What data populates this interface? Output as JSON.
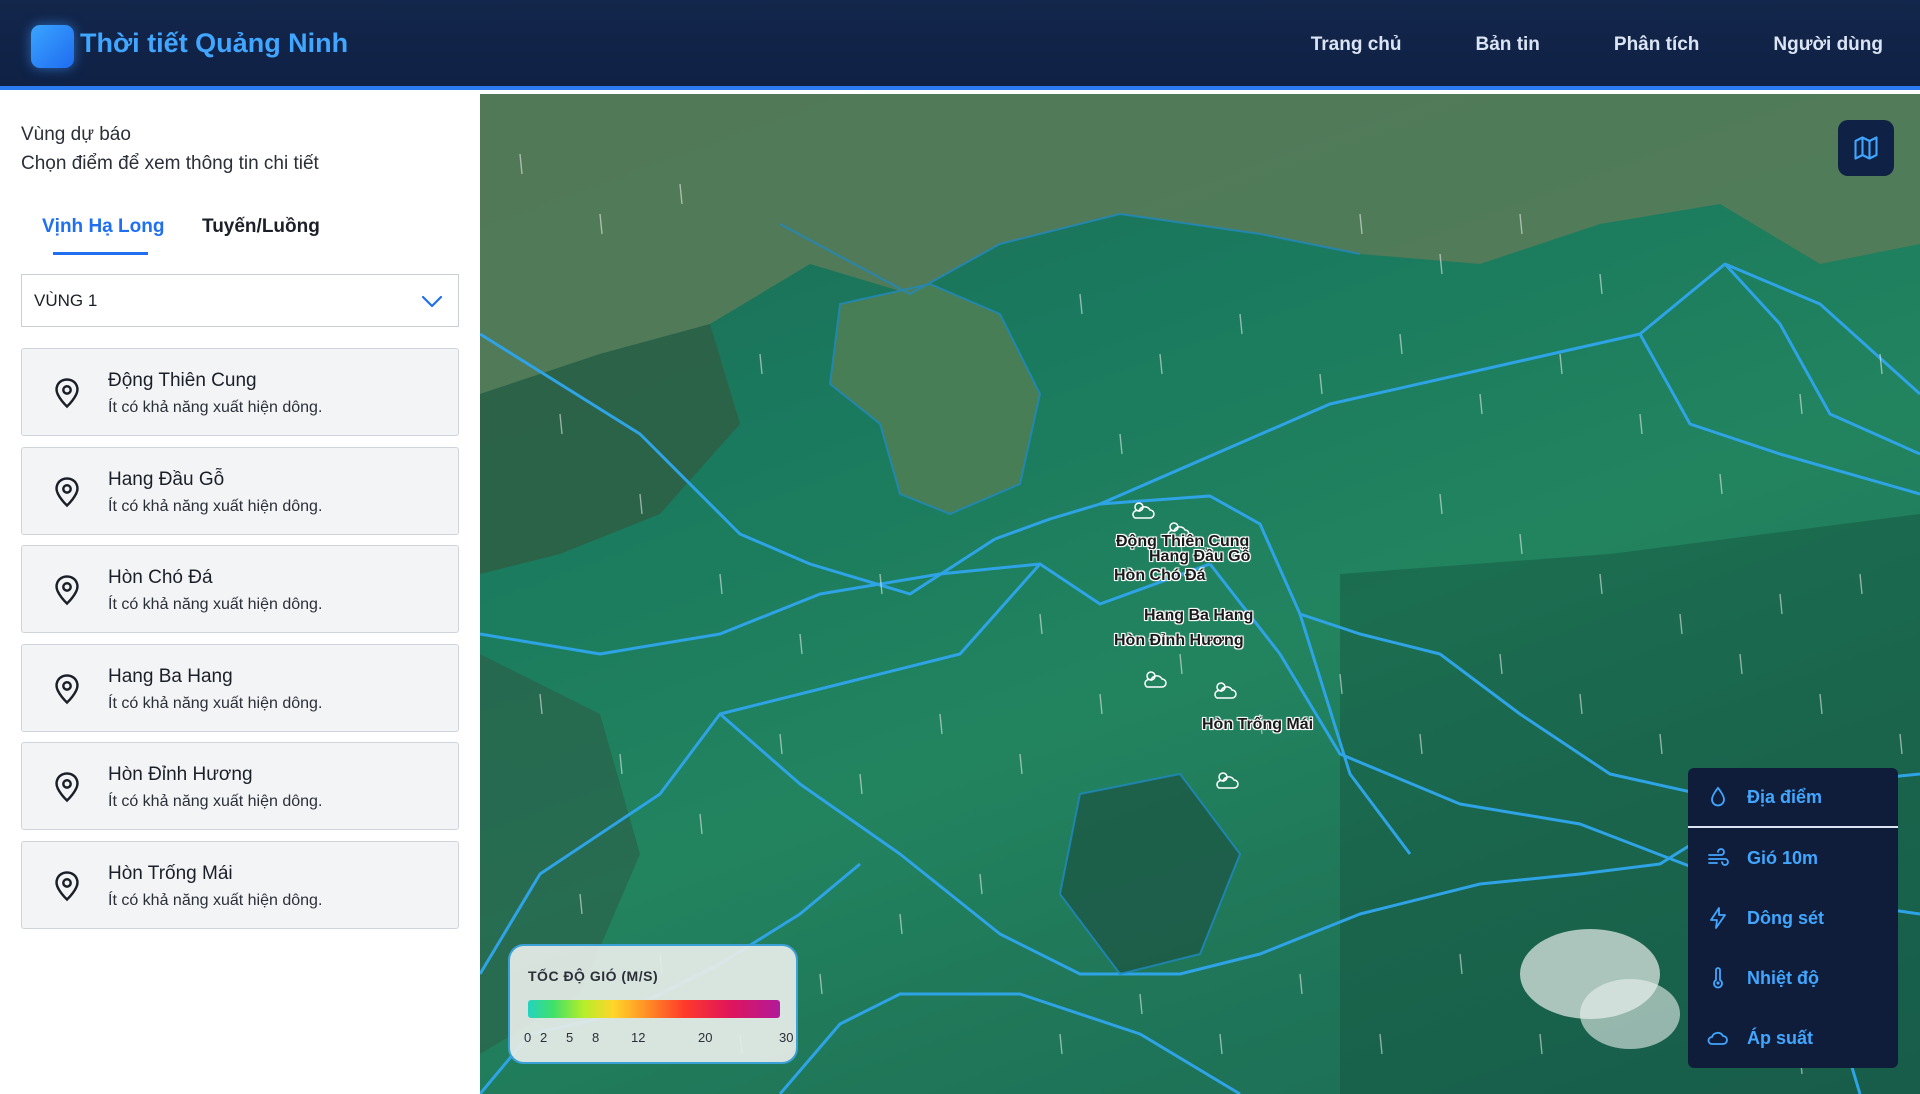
{
  "header": {
    "title": "Thời tiết Quảng Ninh",
    "nav": [
      "Trang chủ",
      "Bản tin",
      "Phân tích",
      "Người dùng"
    ]
  },
  "sidebar": {
    "title": "Vùng dự báo",
    "subtitle": "Chọn điểm để xem thông tin chi tiết",
    "tabs": [
      "Vịnh Hạ Long",
      "Tuyến/Luồng"
    ],
    "active_tab": "Vịnh Hạ Long",
    "select_value": "VÙNG 1",
    "items": [
      {
        "name": "Động Thiên Cung",
        "desc": "Ít có khả năng xuất hiện dông."
      },
      {
        "name": "Hang Đầu Gỗ",
        "desc": "Ít có khả năng xuất hiện dông."
      },
      {
        "name": "Hòn Chó Đá",
        "desc": "Ít có khả năng xuất hiện dông."
      },
      {
        "name": "Hang Ba Hang",
        "desc": "Ít có khả năng xuất hiện dông."
      },
      {
        "name": "Hòn Đỉnh Hương",
        "desc": "Ít có khả năng xuất hiện dông."
      },
      {
        "name": "Hòn Trống Mái",
        "desc": "Ít có khả năng xuất hiện dông."
      }
    ]
  },
  "map": {
    "labels": [
      "Động Thiên Cung",
      "Hang Đầu Gỗ",
      "Hòn Chó Đá",
      "Hang Ba Hang",
      "Hòn Đỉnh Hương",
      "Hòn Trống Mái"
    ],
    "legend": {
      "title": "TỐC ĐỘ GIÓ (M/S)",
      "ticks": [
        "0",
        "2",
        "5",
        "8",
        "12",
        "20",
        "30"
      ]
    },
    "layers": [
      "Địa điểm",
      "Gió 10m",
      "Dông sét",
      "Nhiệt độ",
      "Áp suất"
    ],
    "active_layer": "Địa điểm",
    "colors": {
      "route": "#2ea3e6",
      "accent": "#41a6ff",
      "panel": "#0f1d3a"
    }
  }
}
